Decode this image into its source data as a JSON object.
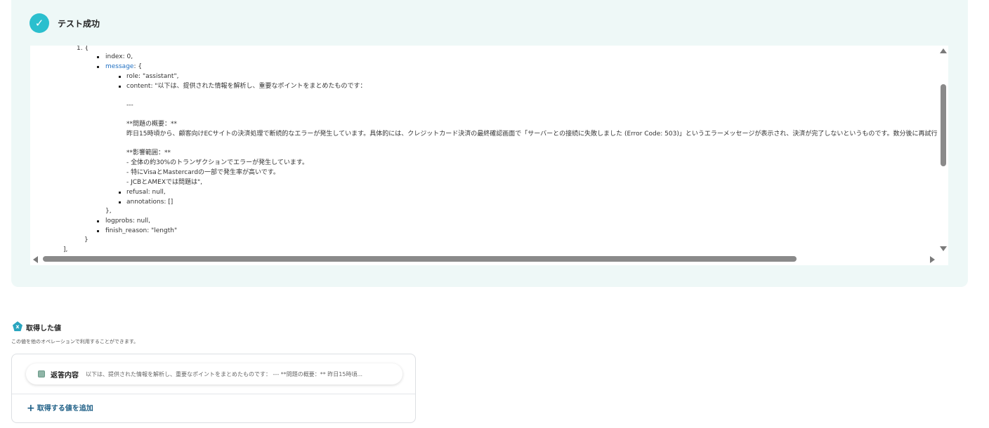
{
  "test_result": {
    "title": "テスト成功"
  },
  "code": {
    "l1": "1. {",
    "l2": "index: 0,",
    "l3_key": "message",
    "l3_rest": ": {",
    "l4": "role: \"assistant\",",
    "l5": "content: \"以下は、提供された情報を解析し、重要なポイントをまとめたものです：",
    "l6": "---",
    "l7": "**問題の概要：**",
    "l8": "昨日15時頃から、顧客向けECサイトの決済処理で断続的なエラーが発生しています。具体的には、クレジットカード決済の最終確認画面で「サーバーとの接続に失敗しました (Error Code: 503)」というエラーメッセージが表示され、決済が完了しないというものです。数分後に再試行すると",
    "l9": "**影響範囲：**",
    "l10": "- 全体の約30%のトランザクションでエラーが発生しています。",
    "l11": "- 特にVisaとMastercardの一部で発生率が高いです。",
    "l12": "- JCBとAMEXでは問題は\",",
    "l13": "refusal: null,",
    "l14": "annotations: []",
    "l15": "},",
    "l16": "logprobs: null,",
    "l17": "finish_reason: \"length\"",
    "l18": "}",
    "l19": "],"
  },
  "fetched": {
    "icon": "x-pentagon-icon",
    "title": "取得した値",
    "description": "この値を他のオペレーションで利用することができます。",
    "item_label": "返答内容",
    "item_value": "以下は、提供された情報を解析し、重要なポイントをまとめたものです： --- **問題の概要：** 昨日15時頃...",
    "add_label": "取得する値を追加"
  },
  "colors": {
    "accent": "#2bbfce",
    "panel_bg": "#eef8f7",
    "link": "#1e5f86"
  }
}
